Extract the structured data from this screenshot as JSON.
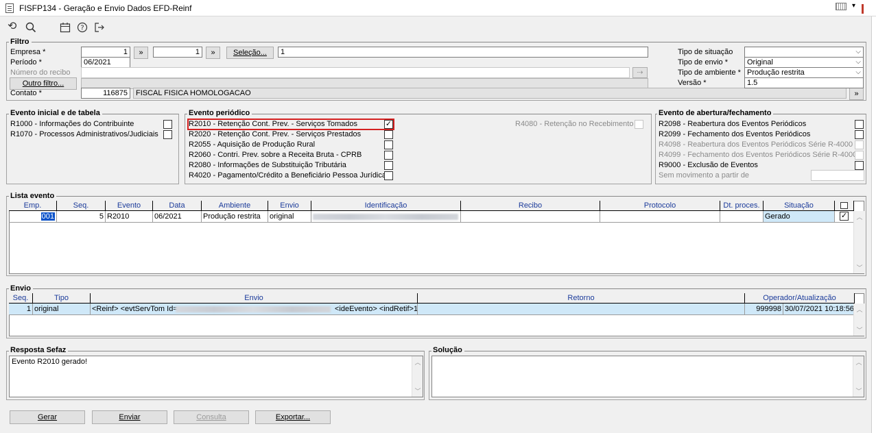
{
  "window": {
    "title": "FISFP134 - Geração e Envio Dados EFD-Reinf"
  },
  "toolbar": {
    "icons": [
      "refresh-icon",
      "search-icon",
      "calendar-icon",
      "help-icon",
      "exit-icon"
    ]
  },
  "filtro": {
    "legend": "Filtro",
    "empresa_label": "Empresa *",
    "empresa_from": "1",
    "empresa_to": "1",
    "more_label": "»",
    "selecao_label": "Seleção...",
    "selecao_value": "1",
    "periodo_label": "Período *",
    "periodo_value": "06/2021",
    "numero_recibo_label": "Número do recibo",
    "outro_filtro_label": "Outro filtro...",
    "contato_label": "Contato *",
    "contato_code": "116875",
    "contato_name": "FISCAL FISICA HOMOLOGACAO",
    "tipo_situacao_label": "Tipo de situação",
    "tipo_situacao_value": "",
    "tipo_envio_label": "Tipo de envio *",
    "tipo_envio_value": "Original",
    "tipo_ambiente_label": "Tipo de ambiente *",
    "tipo_ambiente_value": "Produção restrita",
    "versao_label": "Versão *",
    "versao_value": "1.5"
  },
  "evento_inicial": {
    "legend": "Evento inicial e de tabela",
    "items": [
      {
        "label": "R1000 - Informações do Contribuinte",
        "checked": false
      },
      {
        "label": "R1070 - Processos Administrativos/Judiciais",
        "checked": false
      }
    ]
  },
  "evento_periodico": {
    "legend": "Evento periódico",
    "items": [
      {
        "label": "R2010 - Retenção Cont. Prev. - Serviços Tomados",
        "checked": true
      },
      {
        "label": "R2020 - Retenção Cont. Prev. - Serviços Prestados",
        "checked": false
      },
      {
        "label": "R2055 - Aquisição de Produção Rural",
        "checked": false
      },
      {
        "label": "R2060 - Contri. Prev. sobre a Receita Bruta - CPRB",
        "checked": false
      },
      {
        "label": "R2080 - Informações de Substituição Tributária",
        "checked": false
      },
      {
        "label": "R4020 - Pagamento/Crédito a Beneficiário Pessoa Jurídica",
        "checked": false
      }
    ],
    "r4080_label": "R4080 - Retenção no Recebimento"
  },
  "evento_abertura": {
    "legend": "Evento de abertura/fechamento",
    "items": [
      {
        "label": "R2098 - Reabertura dos Eventos Periódicos",
        "disabled": false
      },
      {
        "label": "R2099 - Fechamento dos Eventos Periódicos",
        "disabled": false
      },
      {
        "label": "R4098 - Reabertura dos Eventos Periódicos Série R-4000",
        "disabled": true
      },
      {
        "label": "R4099 - Fechamento dos Eventos Periódicos Série R-4000",
        "disabled": true
      },
      {
        "label": "R9000 - Exclusão de Eventos",
        "disabled": false
      }
    ],
    "sem_movimento_label": "Sem movimento a partir de"
  },
  "lista_evento": {
    "legend": "Lista evento",
    "columns": [
      "Emp.",
      "Seq.",
      "Evento",
      "Data",
      "Ambiente",
      "Envio",
      "Identificação",
      "Recibo",
      "Protocolo",
      "Dt. proces.",
      "Situação"
    ],
    "rows": [
      {
        "emp": "001",
        "seq": "5",
        "evento": "R2010",
        "data": "06/2021",
        "ambiente": "Produção restrita",
        "envio": "original",
        "identificacao": "",
        "recibo": "",
        "protocolo": "",
        "dt_proces": "",
        "situacao": "Gerado",
        "checked": true
      }
    ]
  },
  "envio": {
    "legend": "Envio",
    "columns": [
      "Seq.",
      "Tipo",
      "Envio",
      "Retorno",
      "Operador/Atualização"
    ],
    "rows": [
      {
        "seq": "1",
        "tipo": "original",
        "envio_pre": "<Reinf> <evtServTom Id=",
        "envio_post": "<ideEvento>   <indRetif>1",
        "retorno": "",
        "operador": "999998",
        "atualizacao": "30/07/2021 10:18:56"
      }
    ]
  },
  "resposta": {
    "legend": "Resposta Sefaz",
    "text": "Evento R2010 gerado!"
  },
  "solucao": {
    "legend": "Solução",
    "text": ""
  },
  "buttons": {
    "gerar": "Gerar",
    "enviar": "Enviar",
    "consulta": "Consulta",
    "exportar": "Exportar..."
  }
}
